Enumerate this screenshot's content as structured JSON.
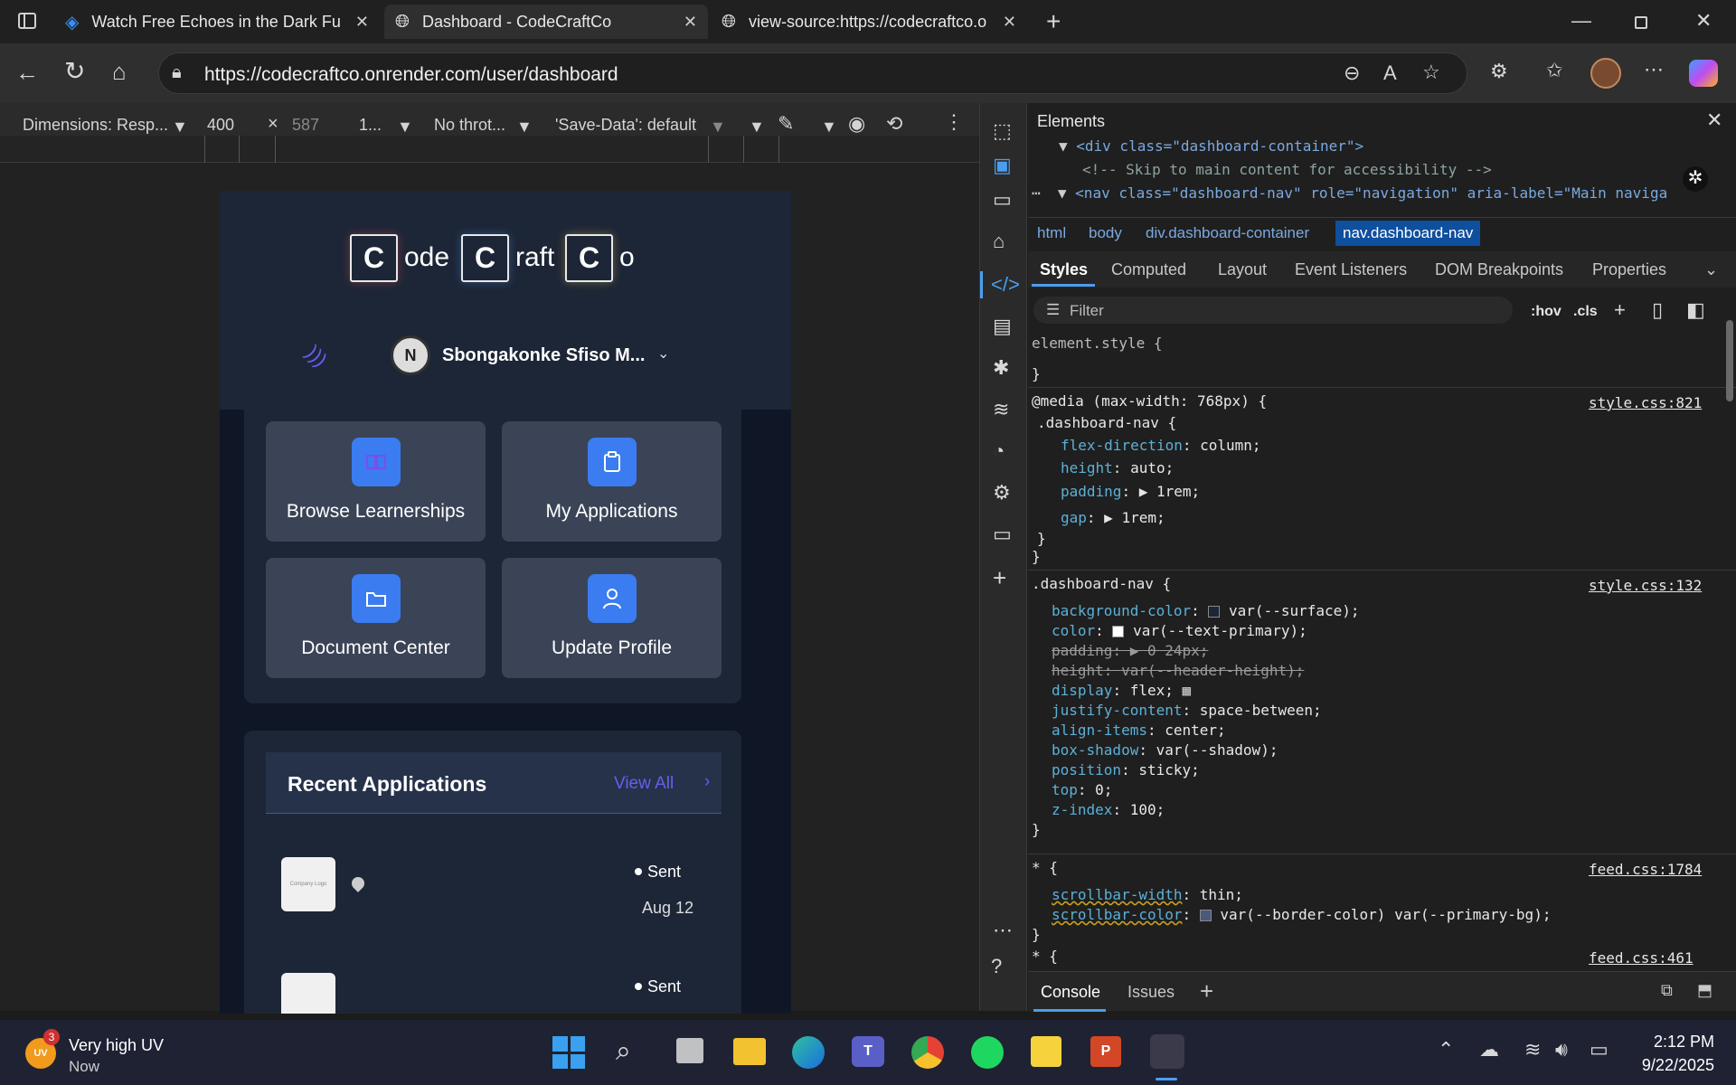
{
  "browser": {
    "tabs": [
      {
        "title": "Watch Free Echoes in the Dark Fu",
        "active": false
      },
      {
        "title": "Dashboard - CodeCraftCo",
        "active": true
      },
      {
        "title": "view-source:https://codecraftco.o",
        "active": false
      }
    ],
    "url": "https://codecraftco.onrender.com/user/dashboard"
  },
  "emulation": {
    "dimensions": "Dimensions: Resp...",
    "width": "400",
    "times": "×",
    "height": "587",
    "zoom": "1...",
    "throttle": "No throt...",
    "save_data": "'Save-Data': default"
  },
  "site": {
    "logo": [
      {
        "box": "C",
        "text": "ode"
      },
      {
        "box": "C",
        "text": "raft"
      },
      {
        "box": "C",
        "text": "o"
      }
    ],
    "user_name": "Sbongakonke Sfiso M...",
    "cards": [
      "Browse Learnerships",
      "My Applications",
      "Document Center",
      "Update Profile"
    ],
    "recent": {
      "title": "Recent Applications",
      "view_all": "View All",
      "items": [
        {
          "logo": "Company Logo",
          "status": "Sent",
          "date": "Aug 12"
        },
        {
          "status": "Sent"
        }
      ]
    }
  },
  "devtools": {
    "panel_title": "Elements",
    "dom": [
      "<div class=\"dashboard-container\">",
      "<!-- Skip to main content for accessibility -->",
      "<nav class=\"dashboard-nav\" role=\"navigation\" aria-label=\"Main naviga"
    ],
    "breadcrumbs": [
      "html",
      "body",
      "div.dashboard-container",
      "nav.dashboard-nav"
    ],
    "tabs": [
      "Styles",
      "Computed",
      "Layout",
      "Event Listeners",
      "DOM Breakpoints",
      "Properties"
    ],
    "filter_placeholder": "Filter",
    "hov": ":hov",
    "cls": ".cls",
    "rules": {
      "element": "element.style {",
      "close": "}",
      "media": "@media (max-width: 768px) {",
      "media_sel": ".dashboard-nav {",
      "media_src": "style.css:821",
      "media_props": [
        {
          "p": "flex-direction",
          "v": "column;"
        },
        {
          "p": "height",
          "v": "auto;"
        },
        {
          "p": "padding",
          "v": "1rem;"
        },
        {
          "p": "gap",
          "v": "1rem;"
        }
      ],
      "nav_sel": ".dashboard-nav {",
      "nav_src": "style.css:132",
      "nav_props": [
        {
          "p": "background-color",
          "v": "var(--surface);",
          "strike": false
        },
        {
          "p": "color",
          "v": "var(--text-primary);",
          "strike": false
        },
        {
          "p": "padding",
          "v": "0 24px;",
          "strike": true
        },
        {
          "p": "height",
          "v": "var(--header-height);",
          "strike": true
        },
        {
          "p": "display",
          "v": "flex;",
          "strike": false
        },
        {
          "p": "justify-content",
          "v": "space-between;",
          "strike": false
        },
        {
          "p": "align-items",
          "v": "center;",
          "strike": false
        },
        {
          "p": "box-shadow",
          "v": "var(--shadow);",
          "strike": false
        },
        {
          "p": "position",
          "v": "sticky;",
          "strike": false
        },
        {
          "p": "top",
          "v": "0;",
          "strike": false
        },
        {
          "p": "z-index",
          "v": "100;",
          "strike": false
        }
      ],
      "star_sel": "* {",
      "star_src": "feed.css:1784",
      "star_props": [
        {
          "p": "scrollbar-width",
          "v": "thin;"
        },
        {
          "p": "scrollbar-color",
          "v": "var(--border-color) var(--primary-bg);"
        }
      ],
      "star2_sel": "* {",
      "star2_src": "feed.css:461"
    },
    "drawer_tabs": [
      "Console",
      "Issues"
    ]
  },
  "taskbar": {
    "weather_badge": "UV",
    "weather_count": "3",
    "weather_title": "Very high UV",
    "weather_sub": "Now",
    "time": "2:12 PM",
    "date": "9/22/2025"
  }
}
